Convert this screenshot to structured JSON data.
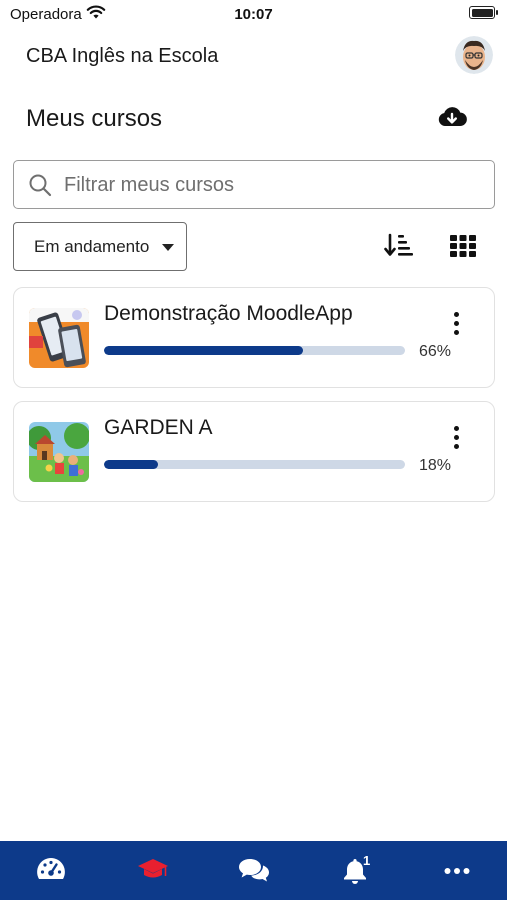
{
  "status_bar": {
    "carrier": "Operadora",
    "time": "10:07"
  },
  "header": {
    "app_title": "CBA Inglês na Escola"
  },
  "page": {
    "title": "Meus cursos"
  },
  "search": {
    "placeholder": "Filtrar meus cursos",
    "value": ""
  },
  "filter": {
    "selected": "Em andamento"
  },
  "courses": [
    {
      "name": "Demonstração MoodleApp",
      "progress_percent": 66,
      "progress_label": "66%"
    },
    {
      "name": "GARDEN A",
      "progress_percent": 18,
      "progress_label": "18%"
    }
  ],
  "tabbar": {
    "notifications_badge": "1",
    "active_tab": "my-courses",
    "active_color": "#e8202f"
  },
  "colors": {
    "primary": "#0d3a8a",
    "progress_track": "#ced8e6",
    "tabbar_icon": "#ffffff"
  }
}
